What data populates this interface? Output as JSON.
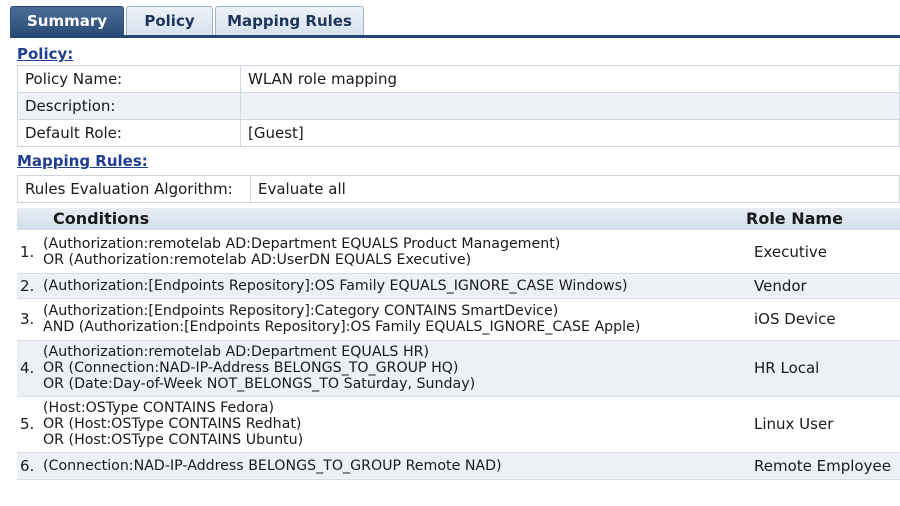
{
  "tabs": [
    {
      "label": "Summary",
      "active": true
    },
    {
      "label": "Policy",
      "active": false
    },
    {
      "label": "Mapping Rules",
      "active": false
    }
  ],
  "policy": {
    "heading": "Policy:",
    "fields": [
      {
        "label": "Policy Name:",
        "value": "WLAN role mapping"
      },
      {
        "label": "Description:",
        "value": ""
      },
      {
        "label": "Default Role:",
        "value": "[Guest]"
      }
    ]
  },
  "mapping": {
    "heading": "Mapping Rules:",
    "algorithm_label": "Rules Evaluation Algorithm:",
    "algorithm_value": "Evaluate all",
    "columns": {
      "conditions": "Conditions",
      "role": "Role Name"
    },
    "rules": [
      {
        "num": "1.",
        "lines": [
          "(Authorization:remotelab AD:Department EQUALS Product Management)",
          "OR (Authorization:remotelab AD:UserDN EQUALS Executive)"
        ],
        "role": "Executive"
      },
      {
        "num": "2.",
        "lines": [
          "(Authorization:[Endpoints Repository]:OS Family EQUALS_IGNORE_CASE Windows)"
        ],
        "role": "Vendor"
      },
      {
        "num": "3.",
        "lines": [
          "(Authorization:[Endpoints Repository]:Category CONTAINS SmartDevice)",
          "AND (Authorization:[Endpoints Repository]:OS Family EQUALS_IGNORE_CASE Apple)"
        ],
        "role": "iOS Device"
      },
      {
        "num": "4.",
        "lines": [
          "(Authorization:remotelab AD:Department EQUALS HR)",
          "OR (Connection:NAD-IP-Address BELONGS_TO_GROUP HQ)",
          "OR (Date:Day-of-Week NOT_BELONGS_TO Saturday, Sunday)"
        ],
        "role": "HR Local"
      },
      {
        "num": "5.",
        "lines": [
          "(Host:OSType CONTAINS Fedora)",
          "OR (Host:OSType CONTAINS Redhat)",
          "OR (Host:OSType CONTAINS Ubuntu)"
        ],
        "role": "Linux User"
      },
      {
        "num": "6.",
        "lines": [
          "(Connection:NAD-IP-Address BELONGS_TO_GROUP Remote NAD)"
        ],
        "role": "Remote Employee"
      }
    ]
  },
  "colors": {
    "accent": "#264672",
    "link": "#1f3d91",
    "row_alt": "#edf1f6"
  }
}
